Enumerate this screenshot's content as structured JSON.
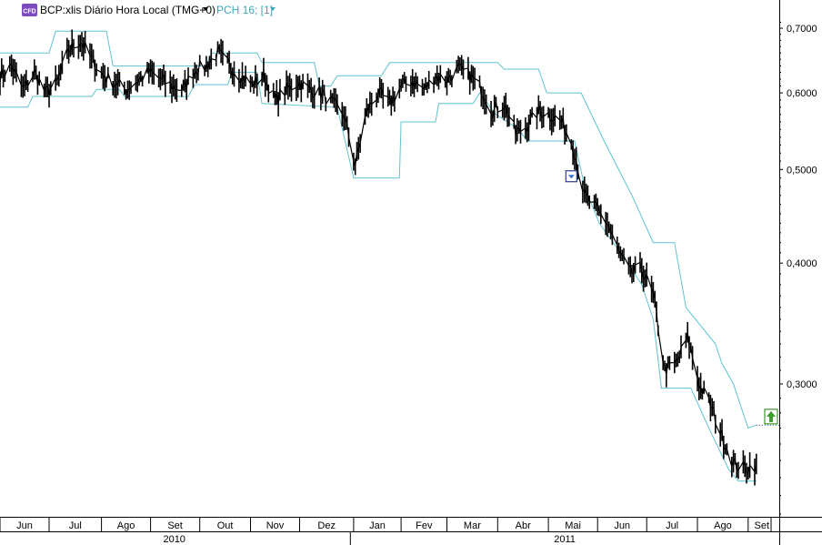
{
  "header": {
    "cfd_badge": "CFD",
    "symbol_label": "BCP:xlis Diário Hora Local (TMG+0)",
    "indicator_label": "PCH 16; [1]"
  },
  "colors": {
    "price": "#000000",
    "channel": "#5fc4d0",
    "badge": "#7d4ac0",
    "axis": "#000000",
    "marker_sell": "#2b3f8f",
    "marker_buy": "#3a9a2a",
    "last_price_line": "#2b3f8f"
  },
  "icons": {
    "sell_marker": "down-arrow-box-icon",
    "buy_marker": "up-arrow-box-icon",
    "dropdown": "triangle-down-icon"
  },
  "chart_data": {
    "type": "line",
    "title": "",
    "xlabel": "",
    "ylabel": "",
    "y_scale": "log",
    "ylim": [
      0.21,
      0.72
    ],
    "y_ticks": [
      0.7,
      0.6,
      0.5,
      0.4,
      0.3
    ],
    "y_tick_labels": [
      "0,7000",
      "0,6000",
      "0,5000",
      "0,4000",
      "0,3000"
    ],
    "xlim": [
      "2010-06-01",
      "2011-09-20"
    ],
    "x_ticks": [
      {
        "date": "2010-06-01",
        "label": "Jun"
      },
      {
        "date": "2010-07-01",
        "label": "Jul"
      },
      {
        "date": "2010-08-02",
        "label": "Ago"
      },
      {
        "date": "2010-09-01",
        "label": "Set"
      },
      {
        "date": "2010-10-01",
        "label": "Out"
      },
      {
        "date": "2010-11-01",
        "label": "Nov"
      },
      {
        "date": "2010-12-01",
        "label": "Dez"
      },
      {
        "date": "2011-01-03",
        "label": "Jan"
      },
      {
        "date": "2011-02-01",
        "label": "Fev"
      },
      {
        "date": "2011-03-01",
        "label": "Mar"
      },
      {
        "date": "2011-04-01",
        "label": "Abr"
      },
      {
        "date": "2011-05-02",
        "label": "Mai"
      },
      {
        "date": "2011-06-01",
        "label": "Jun"
      },
      {
        "date": "2011-07-01",
        "label": "Jul"
      },
      {
        "date": "2011-08-01",
        "label": "Ago"
      },
      {
        "date": "2011-09-01",
        "label": "Set"
      }
    ],
    "year_labels": [
      {
        "label": "2010",
        "start": "2010-06-01",
        "end": "2010-12-31"
      },
      {
        "label": "2011",
        "start": "2011-01-01",
        "end": "2011-09-20"
      }
    ],
    "grid": false,
    "legend": "none",
    "series": [
      {
        "kind": "price",
        "points": [
          [
            "2010-06-01",
            0.625
          ],
          [
            "2010-06-08",
            0.64
          ],
          [
            "2010-06-15",
            0.605
          ],
          [
            "2010-06-22",
            0.63
          ],
          [
            "2010-06-29",
            0.6
          ],
          [
            "2010-07-06",
            0.615
          ],
          [
            "2010-07-13",
            0.665
          ],
          [
            "2010-07-20",
            0.68
          ],
          [
            "2010-07-27",
            0.65
          ],
          [
            "2010-08-03",
            0.625
          ],
          [
            "2010-08-10",
            0.615
          ],
          [
            "2010-08-17",
            0.605
          ],
          [
            "2010-08-24",
            0.618
          ],
          [
            "2010-08-31",
            0.63
          ],
          [
            "2010-09-07",
            0.62
          ],
          [
            "2010-09-14",
            0.61
          ],
          [
            "2010-09-21",
            0.605
          ],
          [
            "2010-09-28",
            0.635
          ],
          [
            "2010-10-05",
            0.64
          ],
          [
            "2010-10-12",
            0.66
          ],
          [
            "2010-10-19",
            0.64
          ],
          [
            "2010-10-26",
            0.625
          ],
          [
            "2010-11-02",
            0.612
          ],
          [
            "2010-11-09",
            0.625
          ],
          [
            "2010-11-16",
            0.59
          ],
          [
            "2010-11-23",
            0.605
          ],
          [
            "2010-11-30",
            0.615
          ],
          [
            "2010-12-07",
            0.605
          ],
          [
            "2010-12-14",
            0.6
          ],
          [
            "2010-12-21",
            0.585
          ],
          [
            "2010-12-28",
            0.57
          ],
          [
            "2011-01-04",
            0.505
          ],
          [
            "2011-01-11",
            0.575
          ],
          [
            "2011-01-18",
            0.6
          ],
          [
            "2011-01-25",
            0.585
          ],
          [
            "2011-02-01",
            0.61
          ],
          [
            "2011-02-08",
            0.618
          ],
          [
            "2011-02-15",
            0.605
          ],
          [
            "2011-02-22",
            0.625
          ],
          [
            "2011-03-01",
            0.62
          ],
          [
            "2011-03-08",
            0.635
          ],
          [
            "2011-03-15",
            0.625
          ],
          [
            "2011-03-22",
            0.605
          ],
          [
            "2011-03-29",
            0.575
          ],
          [
            "2011-04-05",
            0.585
          ],
          [
            "2011-04-12",
            0.545
          ],
          [
            "2011-04-19",
            0.555
          ],
          [
            "2011-04-26",
            0.575
          ],
          [
            "2011-05-03",
            0.57
          ],
          [
            "2011-05-10",
            0.56
          ],
          [
            "2011-05-17",
            0.53
          ],
          [
            "2011-05-24",
            0.47
          ],
          [
            "2011-05-31",
            0.455
          ],
          [
            "2011-06-07",
            0.44
          ],
          [
            "2011-06-14",
            0.41
          ],
          [
            "2011-06-21",
            0.39
          ],
          [
            "2011-06-28",
            0.395
          ],
          [
            "2011-07-05",
            0.37
          ],
          [
            "2011-07-12",
            0.31
          ],
          [
            "2011-07-19",
            0.315
          ],
          [
            "2011-07-26",
            0.335
          ],
          [
            "2011-08-02",
            0.3
          ],
          [
            "2011-08-09",
            0.285
          ],
          [
            "2011-08-16",
            0.265
          ],
          [
            "2011-08-23",
            0.248
          ],
          [
            "2011-08-30",
            0.245
          ],
          [
            "2011-09-06",
            0.248
          ]
        ]
      },
      {
        "kind": "channel-upper",
        "points": [
          [
            "2010-06-01",
            0.66
          ],
          [
            "2010-07-01",
            0.66
          ],
          [
            "2010-07-05",
            0.695
          ],
          [
            "2010-08-05",
            0.695
          ],
          [
            "2010-08-09",
            0.64
          ],
          [
            "2010-10-05",
            0.64
          ],
          [
            "2010-10-08",
            0.66
          ],
          [
            "2010-11-05",
            0.66
          ],
          [
            "2010-11-08",
            0.645
          ],
          [
            "2010-12-10",
            0.645
          ],
          [
            "2010-12-13",
            0.61
          ],
          [
            "2010-12-20",
            0.61
          ],
          [
            "2010-12-24",
            0.625
          ],
          [
            "2011-01-20",
            0.625
          ],
          [
            "2011-01-25",
            0.645
          ],
          [
            "2011-04-01",
            0.645
          ],
          [
            "2011-04-05",
            0.635
          ],
          [
            "2011-04-26",
            0.635
          ],
          [
            "2011-05-01",
            0.6
          ],
          [
            "2011-05-22",
            0.6
          ],
          [
            "2011-06-05",
            0.535
          ],
          [
            "2011-06-22",
            0.47
          ],
          [
            "2011-07-05",
            0.42
          ],
          [
            "2011-07-18",
            0.42
          ],
          [
            "2011-07-25",
            0.36
          ],
          [
            "2011-08-12",
            0.33
          ],
          [
            "2011-08-16",
            0.315
          ],
          [
            "2011-08-23",
            0.3
          ],
          [
            "2011-09-01",
            0.27
          ],
          [
            "2011-09-06",
            0.272
          ]
        ]
      },
      {
        "kind": "channel-lower",
        "points": [
          [
            "2010-06-01",
            0.58
          ],
          [
            "2010-06-18",
            0.58
          ],
          [
            "2010-06-21",
            0.595
          ],
          [
            "2010-07-27",
            0.595
          ],
          [
            "2010-07-30",
            0.605
          ],
          [
            "2010-08-13",
            0.605
          ],
          [
            "2010-08-16",
            0.595
          ],
          [
            "2010-09-24",
            0.595
          ],
          [
            "2010-09-28",
            0.612
          ],
          [
            "2010-10-18",
            0.612
          ],
          [
            "2010-10-21",
            0.63
          ],
          [
            "2010-11-05",
            0.63
          ],
          [
            "2010-11-08",
            0.585
          ],
          [
            "2010-12-24",
            0.58
          ],
          [
            "2011-01-03",
            0.49
          ],
          [
            "2011-01-31",
            0.49
          ],
          [
            "2011-02-01",
            0.56
          ],
          [
            "2011-02-22",
            0.56
          ],
          [
            "2011-02-24",
            0.585
          ],
          [
            "2011-03-17",
            0.585
          ],
          [
            "2011-03-21",
            0.6
          ],
          [
            "2011-03-31",
            0.57
          ],
          [
            "2011-04-14",
            0.55
          ],
          [
            "2011-04-19",
            0.535
          ],
          [
            "2011-05-18",
            0.535
          ],
          [
            "2011-05-24",
            0.48
          ],
          [
            "2011-06-02",
            0.44
          ],
          [
            "2011-06-15",
            0.41
          ],
          [
            "2011-06-28",
            0.38
          ],
          [
            "2011-07-05",
            0.35
          ],
          [
            "2011-07-10",
            0.297
          ],
          [
            "2011-07-28",
            0.297
          ],
          [
            "2011-08-08",
            0.27
          ],
          [
            "2011-08-20",
            0.245
          ],
          [
            "2011-08-26",
            0.238
          ],
          [
            "2011-09-06",
            0.238
          ]
        ]
      }
    ],
    "annotations": [
      {
        "kind": "sell-marker",
        "date": "2011-05-16",
        "value": 0.492
      },
      {
        "kind": "buy-marker",
        "date": "2011-09-20",
        "value": 0.274
      }
    ],
    "last_value_line": {
      "start": "2011-09-06",
      "end": "2011-09-20",
      "value": 0.272
    }
  }
}
